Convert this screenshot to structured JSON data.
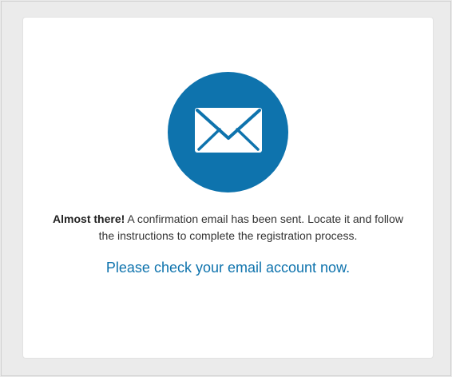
{
  "confirmation": {
    "icon": "envelope-icon",
    "accent_color": "#0e73ad",
    "message_bold": "Almost there!",
    "message_text": " A confirmation email has been sent. Locate it and follow the instructions to complete the registration process.",
    "cta_text": "Please check your email account now."
  }
}
